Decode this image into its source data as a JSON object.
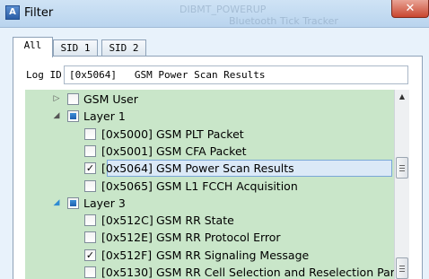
{
  "window": {
    "title": "Filter",
    "close_label": "✕",
    "app_icon_glyph": "A",
    "ghost_left": "DIBMT_POWERUP",
    "ghost_right": "Bluetooth Tick Tracker"
  },
  "tabs": [
    {
      "label": "All",
      "active": true
    },
    {
      "label": "SID 1",
      "active": false
    },
    {
      "label": "SID 2",
      "active": false
    }
  ],
  "log_id": {
    "label": "Log ID",
    "value": "[0x5064]   GSM Power Scan Results"
  },
  "tree": {
    "background_color": "#c9e6c9",
    "items": [
      {
        "type": "group",
        "label": "GSM User",
        "expanded": false,
        "state": "unchecked"
      },
      {
        "type": "group",
        "label": "Layer 1",
        "expanded": true,
        "state": "partial"
      },
      {
        "type": "leaf",
        "code": "[0x5000]",
        "name": "GSM PLT Packet",
        "checked": false
      },
      {
        "type": "leaf",
        "code": "[0x5001]",
        "name": "GSM CFA Packet",
        "checked": false
      },
      {
        "type": "leaf",
        "code": "[0x5064]",
        "name": "GSM Power Scan Results",
        "checked": true,
        "selected": true
      },
      {
        "type": "leaf",
        "code": "[0x5065]",
        "name": "GSM L1 FCCH Acquisition",
        "checked": false
      },
      {
        "type": "group",
        "label": "Layer 3",
        "expanded": true,
        "state": "partial"
      },
      {
        "type": "leaf",
        "code": "[0x512C]",
        "name": "GSM RR State",
        "checked": false
      },
      {
        "type": "leaf",
        "code": "[0x512E]",
        "name": "GSM RR Protocol Error",
        "checked": false
      },
      {
        "type": "leaf",
        "code": "[0x512F]",
        "name": "GSM RR Signaling Message",
        "checked": true
      },
      {
        "type": "leaf",
        "code": "[0x5130]",
        "name": "GSM RR Cell Selection and Reselection Par...",
        "checked": false
      }
    ]
  },
  "scrollbar": {
    "up_arrow": "▲"
  },
  "icons": {
    "collapsed": "arrow-right-icon",
    "expanded": "arrow-down-icon",
    "check": "✓"
  }
}
